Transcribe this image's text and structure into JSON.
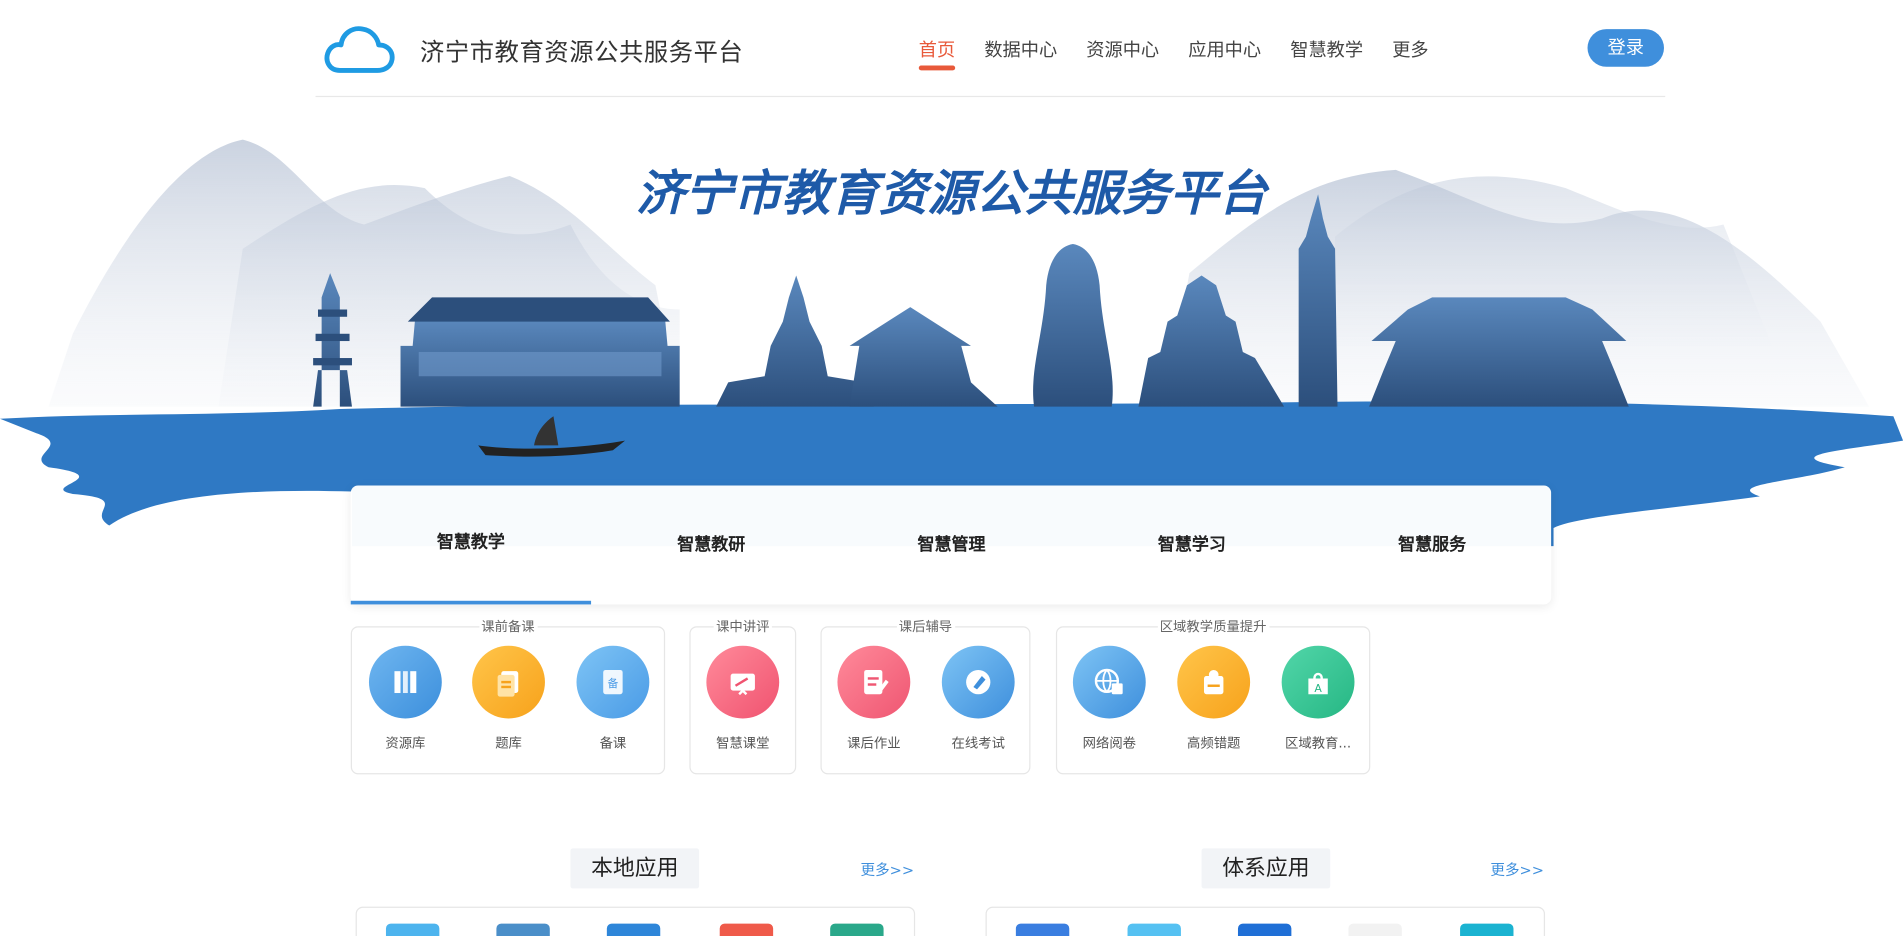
{
  "header": {
    "site_title": "济宁市教育资源公共服务平台",
    "login_label": "登录",
    "nav": [
      "首页",
      "数据中心",
      "资源中心",
      "应用中心",
      "智慧教学",
      "更多"
    ]
  },
  "banner": {
    "title": "济宁市教育资源公共服务平台"
  },
  "tabs": [
    "智慧教学",
    "智慧教研",
    "智慧管理",
    "智慧学习",
    "智慧服务"
  ],
  "groups": [
    {
      "label": "课前备课",
      "apps": [
        "资源库",
        "题库",
        "备课"
      ]
    },
    {
      "label": "课中讲评",
      "apps": [
        "智慧课堂"
      ]
    },
    {
      "label": "课后辅导",
      "apps": [
        "课后作业",
        "在线考试"
      ]
    },
    {
      "label": "区域教学质量提升",
      "apps": [
        "网络阅卷",
        "高频错题",
        "区域教育..."
      ]
    }
  ],
  "sections": {
    "local": {
      "title": "本地应用",
      "more": "更多>>"
    },
    "system": {
      "title": "体系应用",
      "more": "更多>>"
    }
  },
  "colors": {
    "accent": "#3f8fdc",
    "active_nav": "#e8593a",
    "water": "#2f79c4"
  }
}
